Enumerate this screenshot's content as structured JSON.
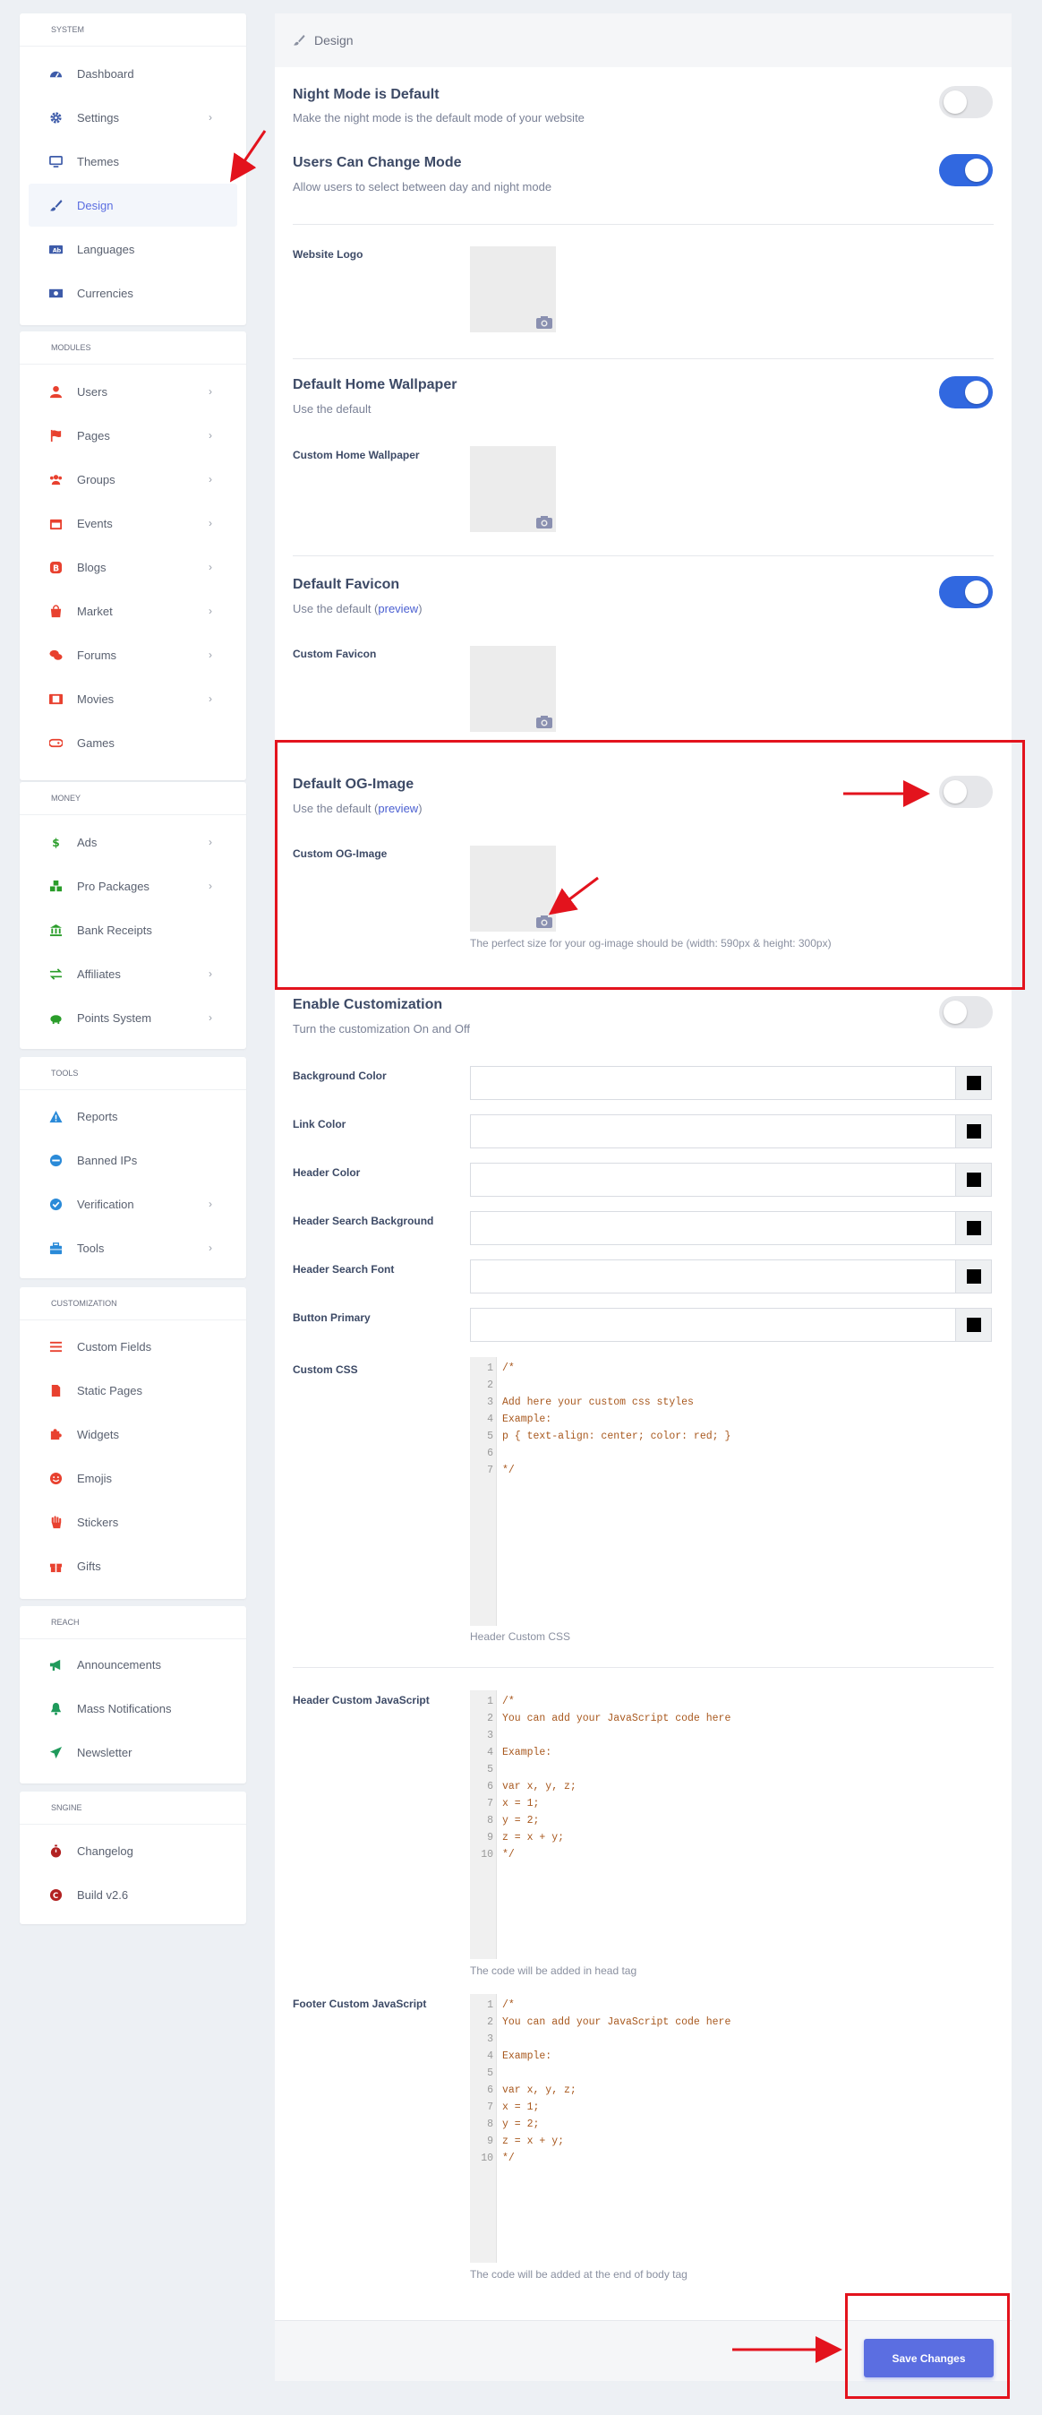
{
  "sidebar": {
    "sections": [
      {
        "title": "SYSTEM",
        "items": [
          {
            "label": "Dashboard",
            "icon": "dashboard-icon",
            "chevron": false
          },
          {
            "label": "Settings",
            "icon": "gear-icon",
            "chevron": true
          },
          {
            "label": "Themes",
            "icon": "monitor-icon",
            "chevron": false
          },
          {
            "label": "Design",
            "icon": "paintbrush-icon",
            "chevron": false,
            "active": true
          },
          {
            "label": "Languages",
            "icon": "language-icon",
            "chevron": false
          },
          {
            "label": "Currencies",
            "icon": "money-icon",
            "chevron": false
          }
        ]
      },
      {
        "title": "MODULES",
        "items": [
          {
            "label": "Users",
            "icon": "user-icon",
            "chevron": true
          },
          {
            "label": "Pages",
            "icon": "flag-icon",
            "chevron": true
          },
          {
            "label": "Groups",
            "icon": "users-icon",
            "chevron": true
          },
          {
            "label": "Events",
            "icon": "calendar-icon",
            "chevron": true
          },
          {
            "label": "Blogs",
            "icon": "blog-icon",
            "chevron": true
          },
          {
            "label": "Market",
            "icon": "shopping-bag-icon",
            "chevron": true
          },
          {
            "label": "Forums",
            "icon": "comments-icon",
            "chevron": true
          },
          {
            "label": "Movies",
            "icon": "film-icon",
            "chevron": true
          },
          {
            "label": "Games",
            "icon": "gamepad-icon",
            "chevron": false
          }
        ]
      },
      {
        "title": "MONEY",
        "items": [
          {
            "label": "Ads",
            "icon": "dollar-icon",
            "chevron": true
          },
          {
            "label": "Pro Packages",
            "icon": "cubes-icon",
            "chevron": true
          },
          {
            "label": "Bank Receipts",
            "icon": "bank-icon",
            "chevron": false
          },
          {
            "label": "Affiliates",
            "icon": "exchange-icon",
            "chevron": true
          },
          {
            "label": "Points System",
            "icon": "piggy-bank-icon",
            "chevron": true
          }
        ]
      },
      {
        "title": "TOOLS",
        "items": [
          {
            "label": "Reports",
            "icon": "warning-icon",
            "chevron": false
          },
          {
            "label": "Banned IPs",
            "icon": "ban-icon",
            "chevron": false
          },
          {
            "label": "Verification",
            "icon": "check-circle-icon",
            "chevron": true
          },
          {
            "label": "Tools",
            "icon": "toolbox-icon",
            "chevron": true
          }
        ]
      },
      {
        "title": "CUSTOMIZATION",
        "items": [
          {
            "label": "Custom Fields",
            "icon": "bars-icon",
            "chevron": false
          },
          {
            "label": "Static Pages",
            "icon": "file-icon",
            "chevron": false
          },
          {
            "label": "Widgets",
            "icon": "puzzle-icon",
            "chevron": false
          },
          {
            "label": "Emojis",
            "icon": "smile-icon",
            "chevron": false
          },
          {
            "label": "Stickers",
            "icon": "hand-icon",
            "chevron": false
          },
          {
            "label": "Gifts",
            "icon": "gift-icon",
            "chevron": false
          }
        ]
      },
      {
        "title": "REACH",
        "items": [
          {
            "label": "Announcements",
            "icon": "bullhorn-icon",
            "chevron": false
          },
          {
            "label": "Mass Notifications",
            "icon": "bell-icon",
            "chevron": false
          },
          {
            "label": "Newsletter",
            "icon": "paper-plane-icon",
            "chevron": false
          }
        ]
      },
      {
        "title": "SNGINE",
        "items": [
          {
            "label": "Changelog",
            "icon": "stopwatch-icon",
            "chevron": false
          },
          {
            "label": "Build v2.6",
            "icon": "copyright-icon",
            "chevron": false
          }
        ]
      }
    ]
  },
  "panel": {
    "title": "Design",
    "night_mode": {
      "title": "Night Mode is Default",
      "desc": "Make the night mode is the default mode of your website",
      "enabled": false
    },
    "users_change": {
      "title": "Users Can Change Mode",
      "desc": "Allow users to select between day and night mode",
      "enabled": true
    },
    "website_logo": {
      "label": "Website Logo"
    },
    "home_wallpaper": {
      "title": "Default Home Wallpaper",
      "desc": "Use the default",
      "enabled": true,
      "custom_label": "Custom Home Wallpaper"
    },
    "favicon": {
      "title": "Default Favicon",
      "desc_prefix": "Use the default (",
      "link": "preview",
      "desc_suffix": ")",
      "enabled": true,
      "custom_label": "Custom Favicon"
    },
    "og_image": {
      "title": "Default OG-Image",
      "desc_prefix": "Use the default (",
      "link": "preview",
      "desc_suffix": ")",
      "enabled": false,
      "custom_label": "Custom OG-Image",
      "hint": "The perfect size for your og-image should be (width: 590px & height: 300px)"
    },
    "customization": {
      "title": "Enable Customization",
      "desc": "Turn the customization On and Off",
      "enabled": false
    },
    "colors": [
      {
        "label": "Background Color",
        "value": ""
      },
      {
        "label": "Link Color",
        "value": ""
      },
      {
        "label": "Header Color",
        "value": ""
      },
      {
        "label": "Header Search Background",
        "value": ""
      },
      {
        "label": "Header Search Font",
        "value": ""
      },
      {
        "label": "Button Primary",
        "value": ""
      }
    ],
    "custom_css": {
      "label": "Custom CSS",
      "hint": "Header Custom CSS",
      "lines": [
        "/*",
        "",
        "Add here your custom css styles",
        "Example:",
        "p { text-align: center; color: red; }",
        "",
        "*/"
      ]
    },
    "header_js": {
      "label": "Header Custom JavaScript",
      "hint": "The code will be added in head tag",
      "lines": [
        "/*",
        "You can add your JavaScript code here",
        "",
        "Example:",
        "",
        "var x, y, z;",
        "x = 1;",
        "y = 2;",
        "z = x + y;",
        "*/"
      ]
    },
    "footer_js": {
      "label": "Footer Custom JavaScript",
      "hint": "The code will be added at the end of body tag",
      "lines": [
        "/*",
        "You can add your JavaScript code here",
        "",
        "Example:",
        "",
        "var x, y, z;",
        "x = 1;",
        "y = 2;",
        "z = x + y;",
        "*/"
      ]
    },
    "save_label": "Save Changes"
  },
  "colors": {
    "accent": "#5b6ee1",
    "toggle_on": "#3168e0",
    "annotation_red": "#e3131d"
  }
}
